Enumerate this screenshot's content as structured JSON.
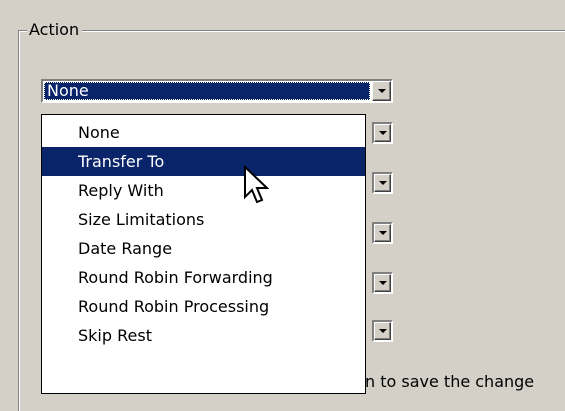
{
  "group": {
    "label": "Action"
  },
  "combo": {
    "selected_value": "None"
  },
  "dropdown": {
    "items": [
      "None",
      "Transfer To",
      "Reply With",
      "Size Limitations",
      "Date Range",
      "Round Robin Forwarding",
      "Round Robin Processing",
      "Skip Rest"
    ],
    "highlighted_item": "Transfer To"
  },
  "hint": {
    "text": "n to save the change"
  },
  "colors": {
    "background": "#d4d0c8",
    "selection": "#0a246a",
    "selection_text": "#ffffff"
  },
  "icons": {
    "dropdown_arrow": "chevron-down-icon",
    "pointer": "mouse-cursor-icon"
  }
}
